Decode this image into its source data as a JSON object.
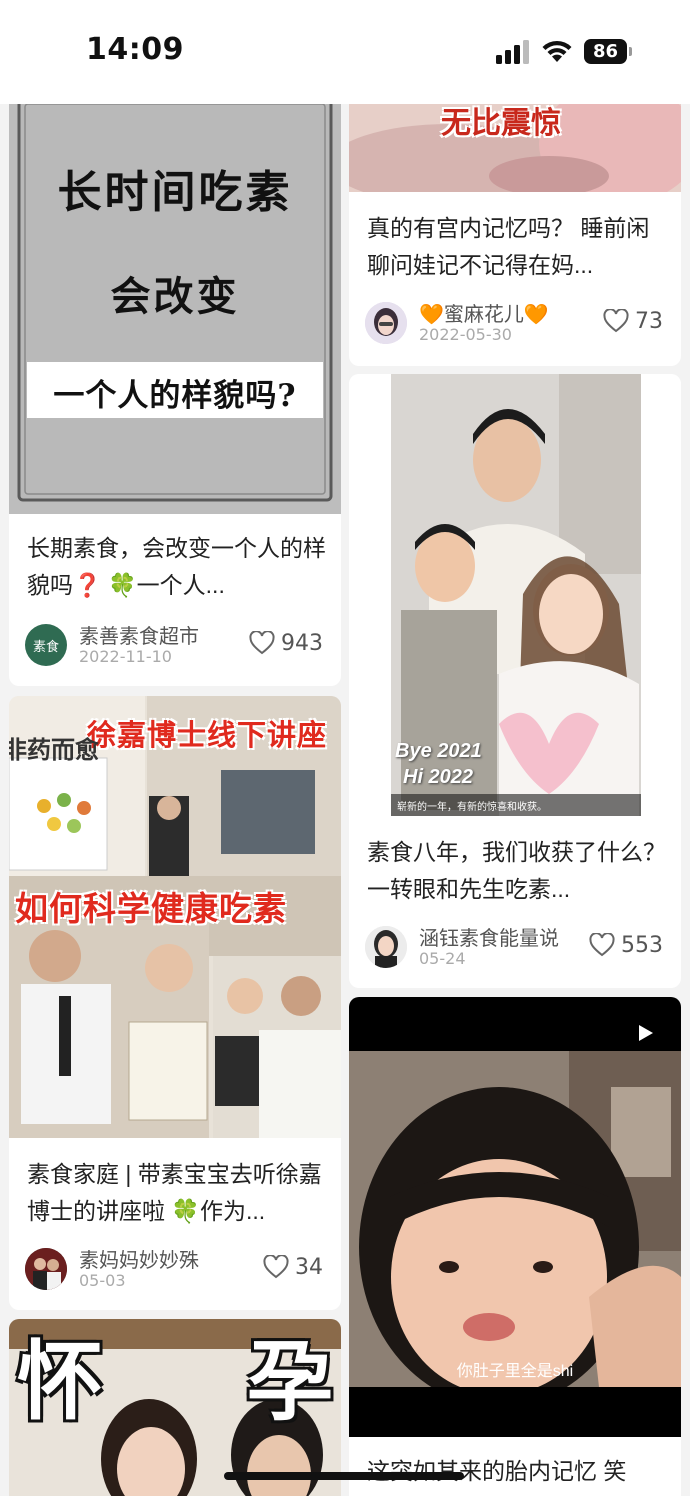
{
  "status_bar": {
    "time": "14:09",
    "battery": "86"
  },
  "left_column": [
    {
      "image_lines": [
        "长时间吃素",
        "会改变",
        "一个人的样貌吗?"
      ],
      "title": "长期素食，会改变一个人的样貌吗❓ 🍀一个人...",
      "author": "素善素食超市",
      "avatar_text": "素食",
      "date": "2022-11-10",
      "likes": "943"
    },
    {
      "image_banners": [
        "徐嘉博士线下讲座",
        "如何科学健康吃素"
      ],
      "book_text": "非药而愈",
      "title": "素食家庭 | 带素宝宝去听徐嘉博士的讲座啦 🍀作为...",
      "author": "素妈妈妙妙殊",
      "date": "05-03",
      "likes": "34"
    },
    {
      "image_words": [
        "怀",
        "孕"
      ]
    }
  ],
  "right_column": [
    {
      "image_text": "无比震惊",
      "title": "真的有宫内记忆吗？ 睡前闲聊问娃记不记得在妈...",
      "author": "🧡蜜麻花儿🧡",
      "date": "2022-05-30",
      "likes": "73"
    },
    {
      "image_overlay_lines": [
        "Bye 2021",
        "Hi 2022"
      ],
      "image_caption": "崭新的一年，有新的惊喜和收获。",
      "title": "素食八年，我们收获了什么？ 一转眼和先生吃素...",
      "author": "涵钰素食能量说",
      "date": "05-24",
      "likes": "553"
    },
    {
      "video_subtitle": "你肚子里全是shi",
      "title": "这突如其来的胎内记忆 笑"
    }
  ]
}
